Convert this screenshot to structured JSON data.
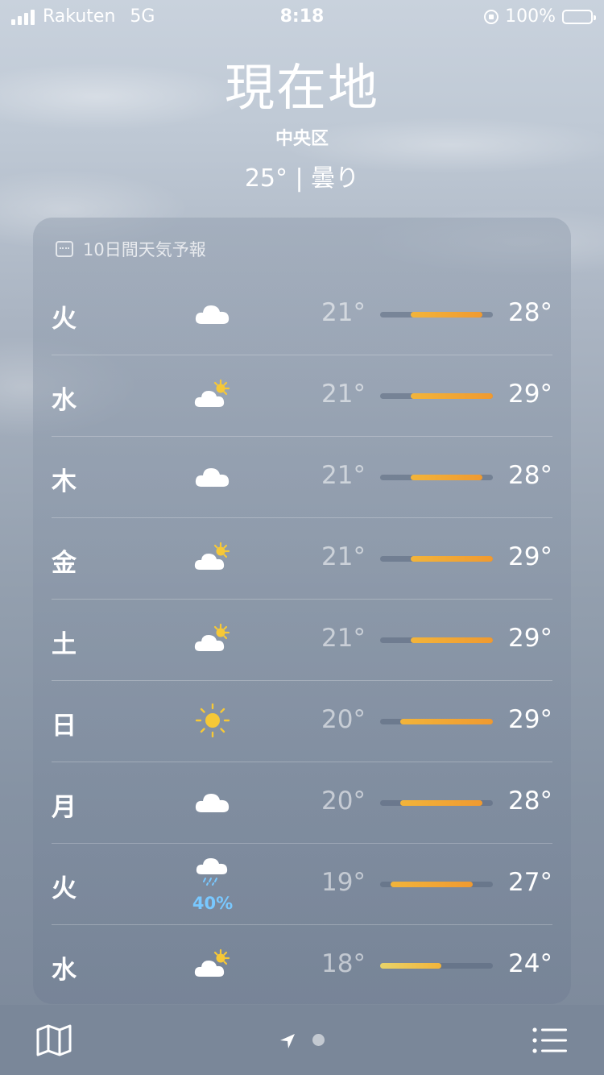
{
  "status_bar": {
    "carrier": "Rakuten",
    "network": "5G",
    "time": "8:18",
    "battery": "100%"
  },
  "header": {
    "location": "現在地",
    "district": "中央区",
    "current": "25°  |  曇り"
  },
  "forecast": {
    "title": "10日間天気予報",
    "range": [
      18,
      29
    ],
    "days": [
      {
        "day": "火",
        "icon": "cloud-icon",
        "low": "21°",
        "high": "28°",
        "low_val": 21,
        "high_val": 28,
        "precip": ""
      },
      {
        "day": "水",
        "icon": "partly-sunny-icon",
        "low": "21°",
        "high": "29°",
        "low_val": 21,
        "high_val": 29,
        "precip": ""
      },
      {
        "day": "木",
        "icon": "cloud-icon",
        "low": "21°",
        "high": "28°",
        "low_val": 21,
        "high_val": 28,
        "precip": ""
      },
      {
        "day": "金",
        "icon": "partly-sunny-icon",
        "low": "21°",
        "high": "29°",
        "low_val": 21,
        "high_val": 29,
        "precip": ""
      },
      {
        "day": "土",
        "icon": "partly-sunny-icon",
        "low": "21°",
        "high": "29°",
        "low_val": 21,
        "high_val": 29,
        "precip": ""
      },
      {
        "day": "日",
        "icon": "sun-icon",
        "low": "20°",
        "high": "29°",
        "low_val": 20,
        "high_val": 29,
        "precip": ""
      },
      {
        "day": "月",
        "icon": "cloud-icon",
        "low": "20°",
        "high": "28°",
        "low_val": 20,
        "high_val": 28,
        "precip": ""
      },
      {
        "day": "火",
        "icon": "rain-icon",
        "low": "19°",
        "high": "27°",
        "low_val": 19,
        "high_val": 27,
        "precip": "40%"
      },
      {
        "day": "水",
        "icon": "partly-sunny-icon",
        "low": "18°",
        "high": "24°",
        "low_val": 18,
        "high_val": 24,
        "precip": ""
      }
    ]
  },
  "bottom_bar": {
    "icons": [
      "map-icon",
      "location-arrow-icon",
      "page-dot",
      "list-icon"
    ]
  },
  "colors": {
    "bar_cool": "#e8d36a",
    "bar_mid": "#f2b43a",
    "bar_warm": "#f09a30",
    "precip": "#79c8ff",
    "bottom_bar": "#7a8799"
  }
}
